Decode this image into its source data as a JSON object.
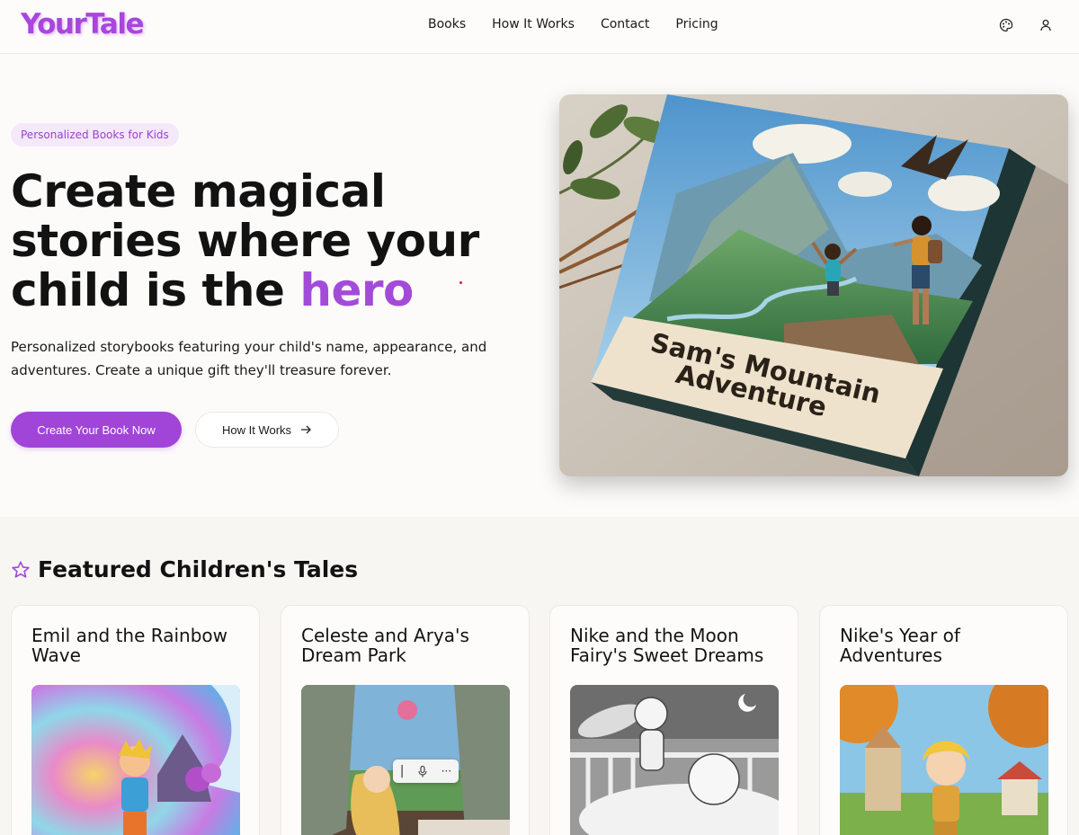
{
  "header": {
    "logo": "YourTale",
    "nav": [
      "Books",
      "How It Works",
      "Contact",
      "Pricing"
    ],
    "icons": [
      "palette-icon",
      "user-icon"
    ]
  },
  "hero": {
    "badge": "Personalized Books for Kids",
    "title_line1": "Create magical",
    "title_line2": "stories where your",
    "title_line3_prefix": "child is the ",
    "title_accent": "hero",
    "lead": "Personalized storybooks featuring your child's name, appearance, and adventures. Create a unique gift they'll treasure forever.",
    "cta_primary": "Create Your Book Now",
    "cta_secondary": "How It Works",
    "book_cover_title_line1": "Sam's Mountain",
    "book_cover_title_line2": "Adventure"
  },
  "featured": {
    "title": "Featured Children's Tales",
    "cards": [
      {
        "title": "Emil and the Rainbow Wave"
      },
      {
        "title": "Celeste and Arya's Dream Park"
      },
      {
        "title": "Nike and the Moon Fairy's Sweet Dreams"
      },
      {
        "title": "Nike's Year of Adventures"
      }
    ]
  },
  "colors": {
    "brand": "#a846dd",
    "accent": "#a34bd9",
    "background": "#fcfbfa"
  }
}
